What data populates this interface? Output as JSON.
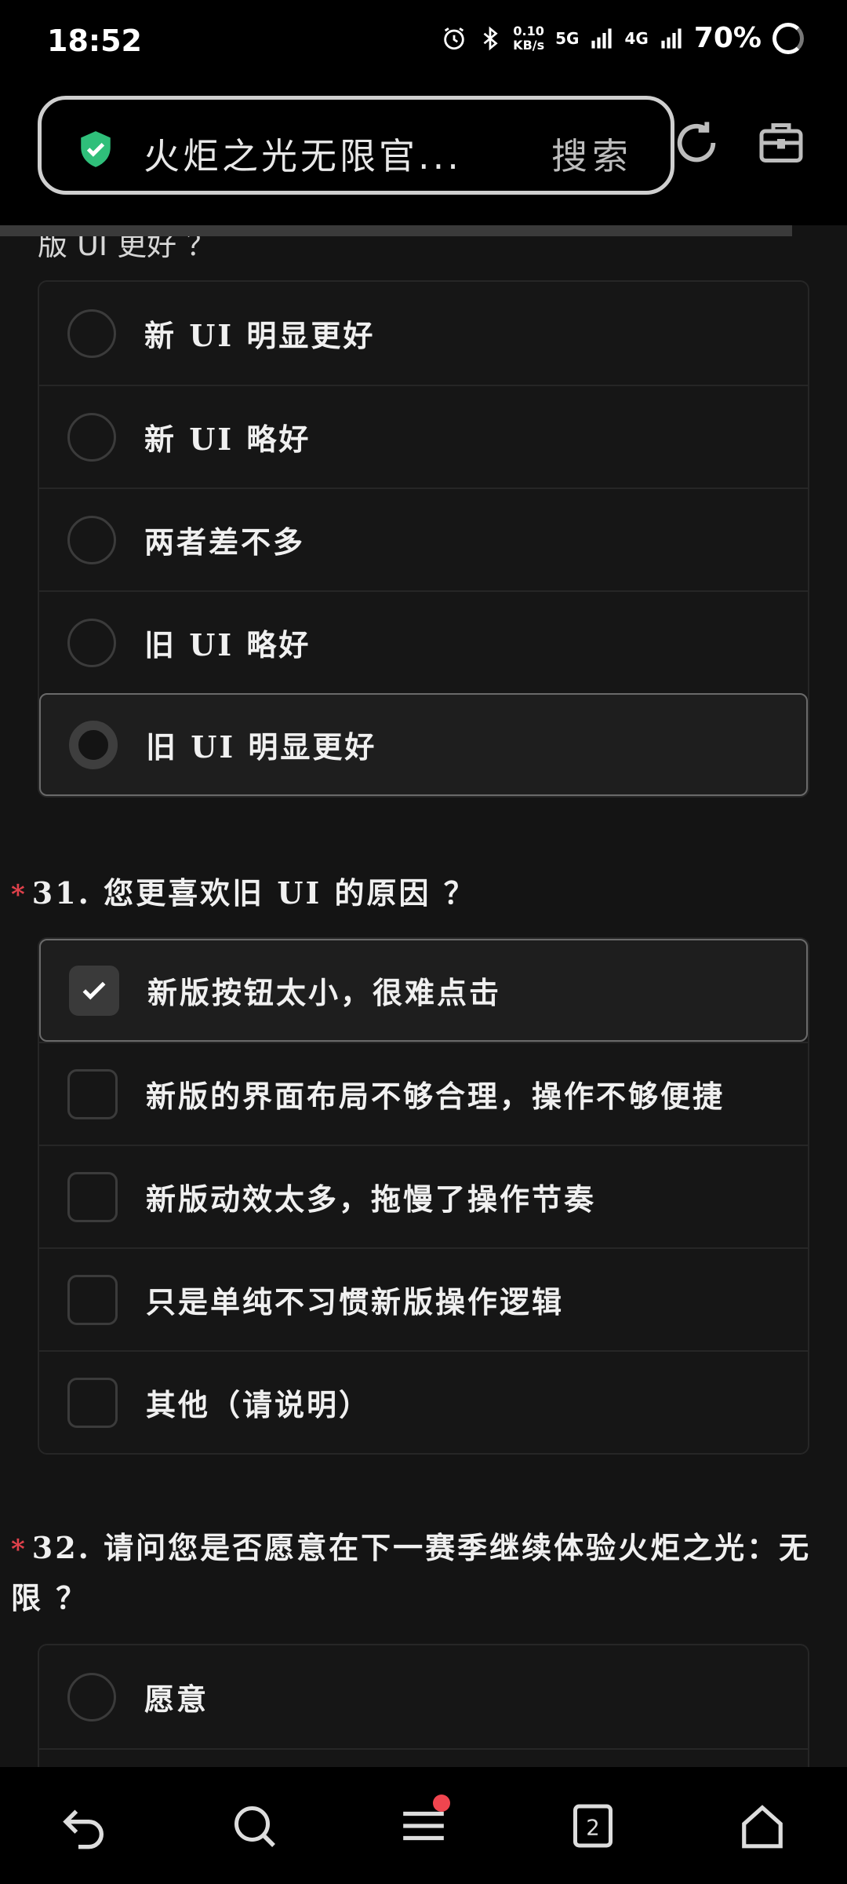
{
  "status_bar": {
    "time": "18:52",
    "net_speed_value": "0.10",
    "net_speed_unit": "KB/s",
    "signal_1": "5G",
    "signal_2": "4G",
    "battery": "70%"
  },
  "browser": {
    "url_title": "火炬之光无限官...",
    "search_label": "搜索"
  },
  "survey": {
    "cut_off_text": "版 UI 更好 ？",
    "q30_options": [
      {
        "label": "新 UI 明显更好",
        "selected": false
      },
      {
        "label": "新 UI 略好",
        "selected": false
      },
      {
        "label": "两者差不多",
        "selected": false
      },
      {
        "label": "旧 UI 略好",
        "selected": false
      },
      {
        "label": "旧 UI 明显更好",
        "selected": true
      }
    ],
    "q31": {
      "required_mark": "*",
      "title": "31. 您更喜欢旧 UI 的原因 ？",
      "options": [
        {
          "label": "新版按钮太小，很难点击",
          "checked": true
        },
        {
          "label": "新版的界面布局不够合理，操作不够便捷",
          "checked": false
        },
        {
          "label": "新版动效太多，拖慢了操作节奏",
          "checked": false
        },
        {
          "label": "只是单纯不习惯新版操作逻辑",
          "checked": false
        },
        {
          "label": "其他（请说明）",
          "checked": false
        }
      ]
    },
    "q32": {
      "required_mark": "*",
      "title": "32. 请问您是否愿意在下一赛季继续体验火炬之光：无限 ？",
      "options": [
        {
          "label": "愿意",
          "selected": false
        }
      ]
    }
  },
  "bottom_nav": {
    "tabs_count": "2"
  },
  "colors": {
    "accent_required": "#e0414b",
    "shield_green": "#2fbf7a",
    "badge_red": "#f0454f"
  }
}
